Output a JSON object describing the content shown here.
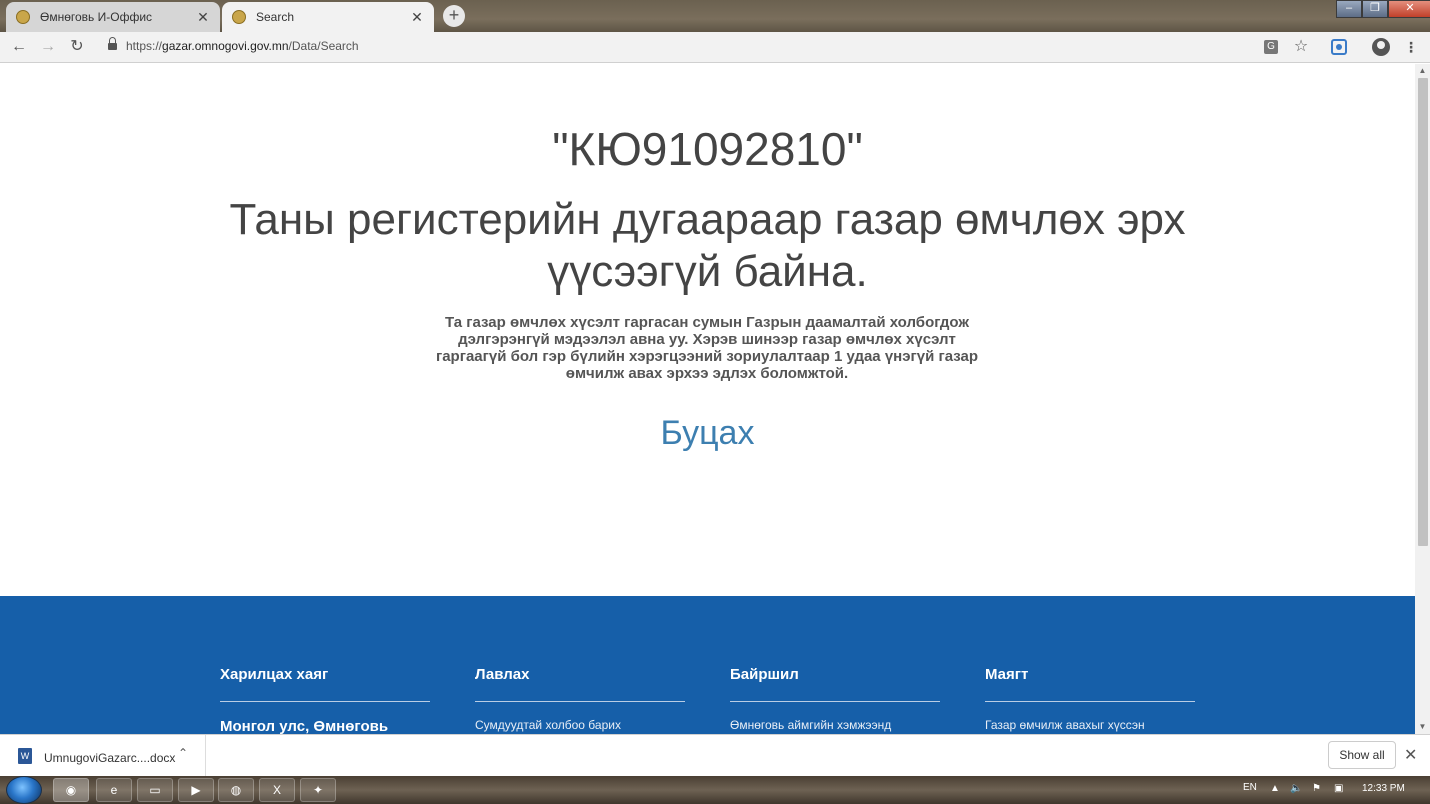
{
  "browser": {
    "tabs": [
      {
        "label": "Өмнөговь И-Оффис",
        "active": false
      },
      {
        "label": "Search",
        "active": true
      }
    ],
    "new_tab_label": "+",
    "url_scheme": "https://",
    "url_host": "gazar.omnogovi.gov.mn",
    "url_path": "/Data/Search"
  },
  "page": {
    "reg_number": "\"КЮ91092810\"",
    "main_message": "Таны регистерийн дугаараар газар өмчлөх эрх үүсээгүй байна.",
    "detail_text": "Та газар өмчлөх хүсэлт гаргасан сумын Газрын даамалтай холбогдож дэлгэрэнгүй мэдээлэл авна уу. Хэрэв шинээр газар өмчлөх хүсэлт гаргаагүй бол гэр бүлийн хэрэгцээний зориулалтаар 1 удаа үнэгүй газар өмчилж авах эрхээ эдлэх боломжтой.",
    "back_link": "Буцах"
  },
  "footer": {
    "columns": [
      {
        "heading": "Харилцах хаяг",
        "text": "Монгол улс, Өмнөговь"
      },
      {
        "heading": "Лавлах",
        "text": "Сумдуудтай холбоо барих"
      },
      {
        "heading": "Байршил",
        "text": "Өмнөговь аймгийн хэмжээнд"
      },
      {
        "heading": "Маягт",
        "text": "Газар өмчилж авахыг хүссэн"
      }
    ]
  },
  "downloads": {
    "file_name": "UmnugoviGazarc....docx",
    "show_all": "Show all"
  },
  "taskbar": {
    "language": "EN",
    "time": "12:33 PM"
  }
}
